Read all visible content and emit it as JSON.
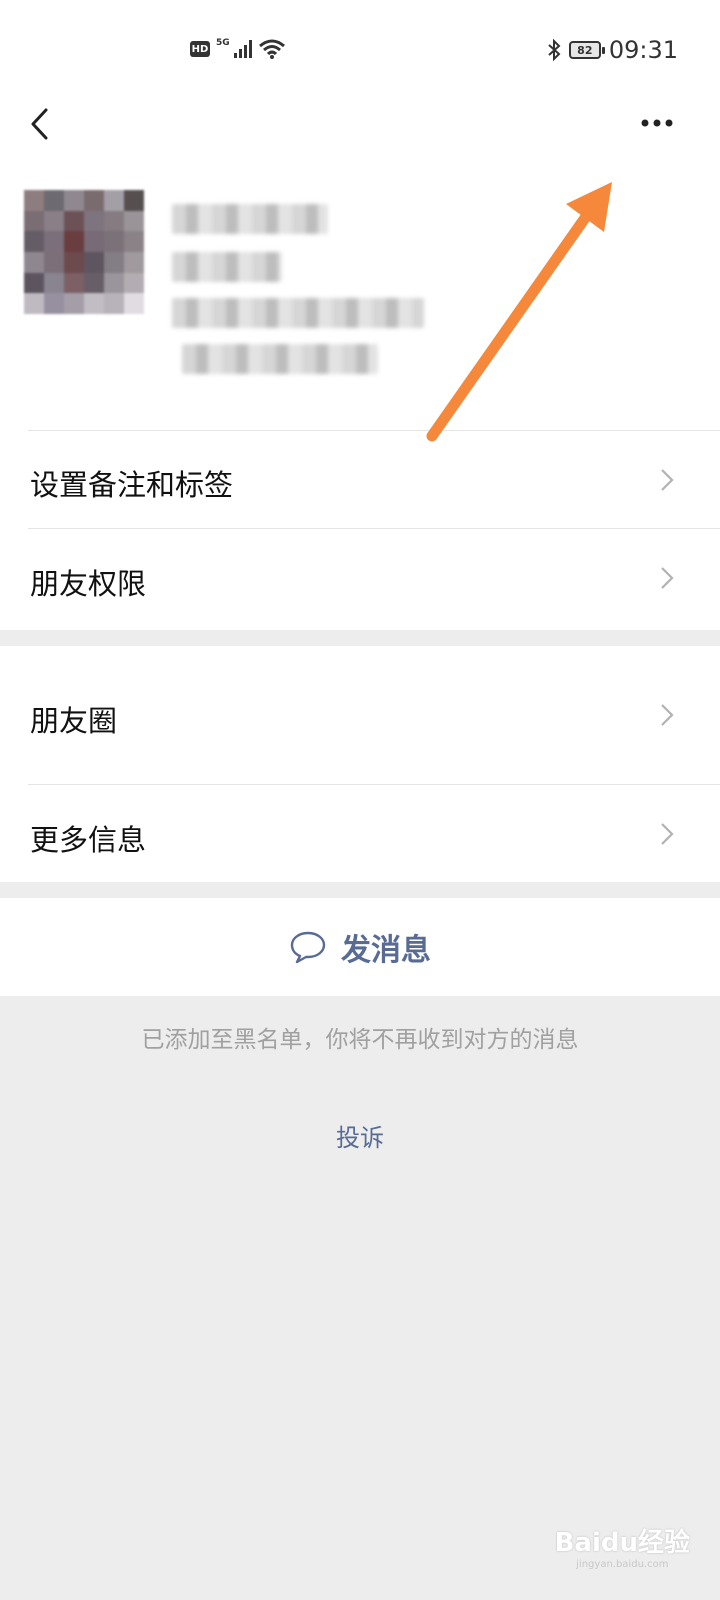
{
  "status_bar": {
    "hd": "HD",
    "network": "5G",
    "battery": "82",
    "time": "09:31"
  },
  "header": {
    "back_icon": "chevron-left-icon",
    "more_icon": "more-dots-icon"
  },
  "menu_section_1": [
    {
      "label": "设置备注和标签"
    },
    {
      "label": "朋友权限"
    }
  ],
  "menu_section_2": [
    {
      "label": "朋友圈"
    },
    {
      "label": "更多信息"
    }
  ],
  "send_message": {
    "label": "发消息",
    "icon": "chat-bubble-icon"
  },
  "blocked_note": "已添加至黑名单，你将不再收到对方的消息",
  "complain_link": "投诉",
  "watermark": {
    "brand": "Baidu经验",
    "url": "jingyan.baidu.com"
  },
  "colors": {
    "link_blue": "#576b95",
    "annotation_arrow": "#f5883a",
    "background": "#ededed"
  }
}
